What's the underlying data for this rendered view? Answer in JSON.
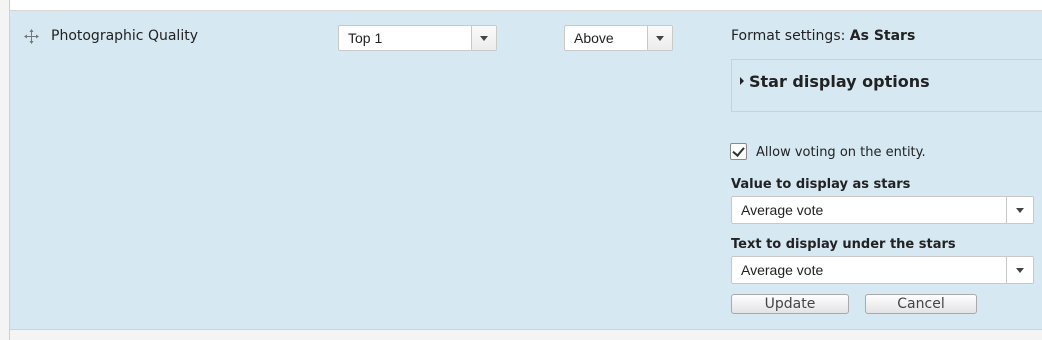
{
  "row": {
    "field_label": "Photographic Quality",
    "label_position": "Top 1",
    "label_display": "Above"
  },
  "format": {
    "prefix": "Format settings:",
    "formatter": "As Stars",
    "fieldset_legend": "Star display options"
  },
  "options": {
    "allow_voting_label": "Allow voting on the entity.",
    "allow_voting_checked": true,
    "value_label": "Value to display as stars",
    "value_selected": "Average vote",
    "text_label": "Text to display under the stars",
    "text_selected": "Average vote"
  },
  "buttons": {
    "update": "Update",
    "cancel": "Cancel"
  },
  "icons": {
    "drag": "drag-handle-icon",
    "dropdown": "chevron-down-icon",
    "expand": "triangle-right-icon",
    "check": "check-icon"
  },
  "colors": {
    "row_background": "#d6e8f1",
    "page_background": "#f4f4f4"
  }
}
